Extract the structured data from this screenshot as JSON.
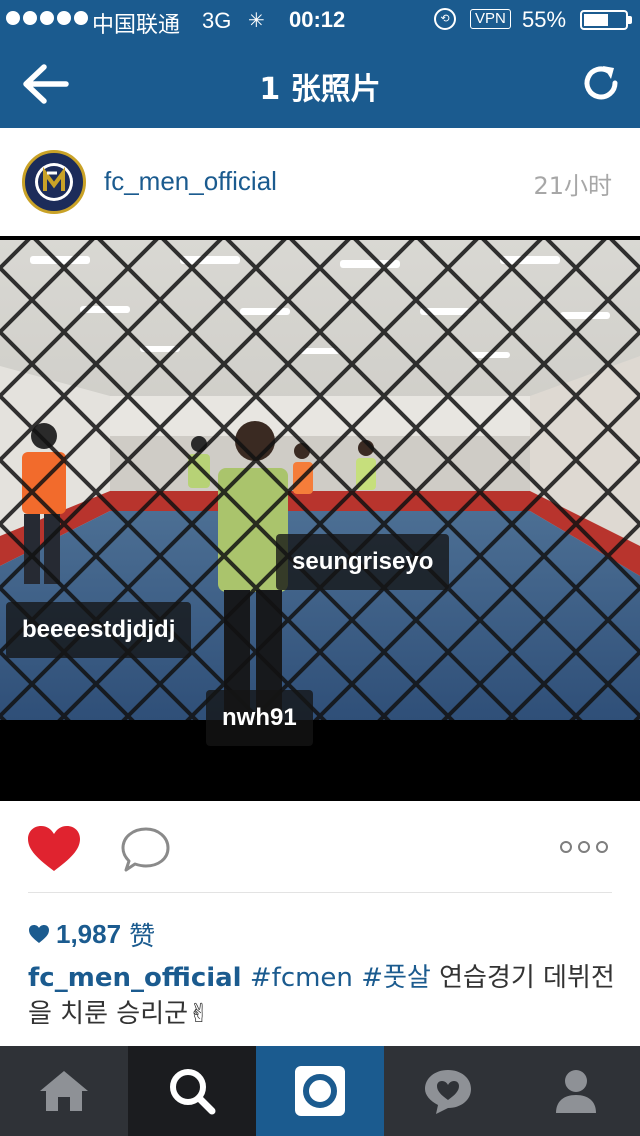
{
  "status_bar": {
    "carrier": "中国联通",
    "network": "3G",
    "time": "00:12",
    "vpn": "VPN",
    "battery": "55%"
  },
  "nav": {
    "title": "1 张照片",
    "back_icon": "arrow-left-icon",
    "refresh_icon": "refresh-icon"
  },
  "post": {
    "username": "fc_men_official",
    "time_ago": "21小时",
    "avatar_text": "FCMEN",
    "photo_tags": [
      "seungriseyo",
      "beeeestdjdjdj",
      "nwh91"
    ],
    "likes_count": "1,987",
    "likes_label": "赞",
    "caption_user": "fc_men_official",
    "caption_hashtags": [
      "#fcmen",
      "#풋살"
    ],
    "caption_text": "연습경기 데뷔전을 치룬 승리군✌"
  },
  "tabbar": {
    "items": [
      {
        "icon": "home-icon"
      },
      {
        "icon": "search-icon"
      },
      {
        "icon": "camera-icon"
      },
      {
        "icon": "activity-heart-icon"
      },
      {
        "icon": "profile-icon"
      }
    ]
  },
  "colors": {
    "brand": "#1b5b8f",
    "like": "#e0232f",
    "tabbar": "#2f3237"
  }
}
